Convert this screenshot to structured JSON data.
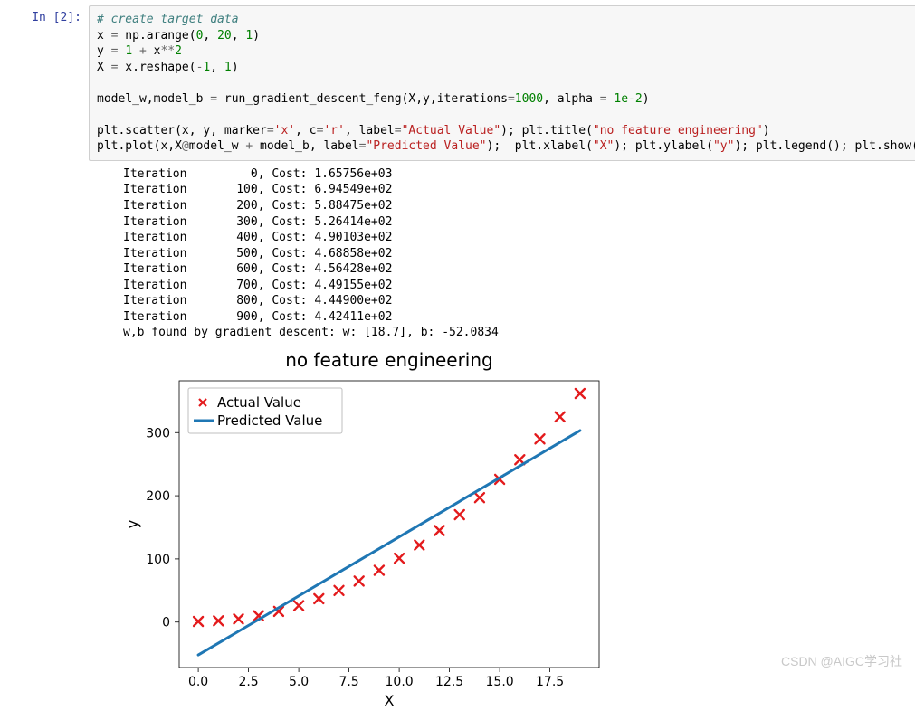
{
  "prompt": "In  [2]:",
  "code": {
    "line1_comment": "# create target data",
    "l2a": "x ",
    "l2b": "=",
    "l2c": " np.arange(",
    "l2d": "0",
    "l2e": ", ",
    "l2f": "20",
    "l2g": ", ",
    "l2h": "1",
    "l2i": ")",
    "l3a": "y ",
    "l3b": "=",
    "l3c": " ",
    "l3d": "1",
    "l3e": " ",
    "l3f": "+",
    "l3g": " x",
    "l3h": "**",
    "l3i": "2",
    "l4a": "X ",
    "l4b": "=",
    "l4c": " x.reshape(",
    "l4d": "-",
    "l4e": "1",
    "l4f": ", ",
    "l4g": "1",
    "l4h": ")",
    "l6a": "model_w,model_b ",
    "l6b": "=",
    "l6c": " run_gradient_descent_feng(X,y,iterations",
    "l6d": "=",
    "l6e": "1000",
    "l6f": ", alpha ",
    "l6g": "=",
    "l6h": " ",
    "l6i": "1e-2",
    "l6j": ")",
    "l8a": "plt.scatter(x, y, marker",
    "l8b": "=",
    "l8c": "'x'",
    "l8d": ", c",
    "l8e": "=",
    "l8f": "'r'",
    "l8g": ", label",
    "l8h": "=",
    "l8i": "\"Actual Value\"",
    "l8j": "); plt.title(",
    "l8k": "\"no feature engineering\"",
    "l8l": ")",
    "l9a": "plt.plot(x,X",
    "l9b": "@",
    "l9c": "model_w ",
    "l9d": "+",
    "l9e": " model_b, label",
    "l9f": "=",
    "l9g": "\"Predicted Value\"",
    "l9h": ");  plt.xlabel(",
    "l9i": "\"X\"",
    "l9j": "); plt.ylabel(",
    "l9k": "\"y\"",
    "l9l": "); plt.legend(); plt.show()"
  },
  "output_text": "Iteration         0, Cost: 1.65756e+03\nIteration       100, Cost: 6.94549e+02\nIteration       200, Cost: 5.88475e+02\nIteration       300, Cost: 5.26414e+02\nIteration       400, Cost: 4.90103e+02\nIteration       500, Cost: 4.68858e+02\nIteration       600, Cost: 4.56428e+02\nIteration       700, Cost: 4.49155e+02\nIteration       800, Cost: 4.44900e+02\nIteration       900, Cost: 4.42411e+02\nw,b found by gradient descent: w: [18.7], b: -52.0834",
  "chart_data": {
    "type": "scatter+line",
    "title": "no feature engineering",
    "xlabel": "X",
    "ylabel": "y",
    "xlim": [
      -0.95,
      19.95
    ],
    "ylim": [
      -72.0,
      382.0
    ],
    "xticks": [
      0.0,
      2.5,
      5.0,
      7.5,
      10.0,
      12.5,
      15.0,
      17.5
    ],
    "yticks": [
      0,
      100,
      200,
      300
    ],
    "series": [
      {
        "name": "Actual Value",
        "kind": "scatter",
        "color": "#e31a1c",
        "marker": "x",
        "x": [
          0,
          1,
          2,
          3,
          4,
          5,
          6,
          7,
          8,
          9,
          10,
          11,
          12,
          13,
          14,
          15,
          16,
          17,
          18,
          19
        ],
        "y": [
          1,
          2,
          5,
          10,
          17,
          26,
          37,
          50,
          65,
          82,
          101,
          122,
          145,
          170,
          197,
          226,
          257,
          290,
          325,
          362
        ]
      },
      {
        "name": "Predicted Value",
        "kind": "line",
        "color": "#1f77b4",
        "linewidth": 3,
        "x": [
          0,
          19
        ],
        "y": [
          -52.0834,
          303.2166
        ]
      }
    ],
    "legend": {
      "position": "upper-left"
    }
  },
  "watermark": "CSDN @AIGC学习社"
}
